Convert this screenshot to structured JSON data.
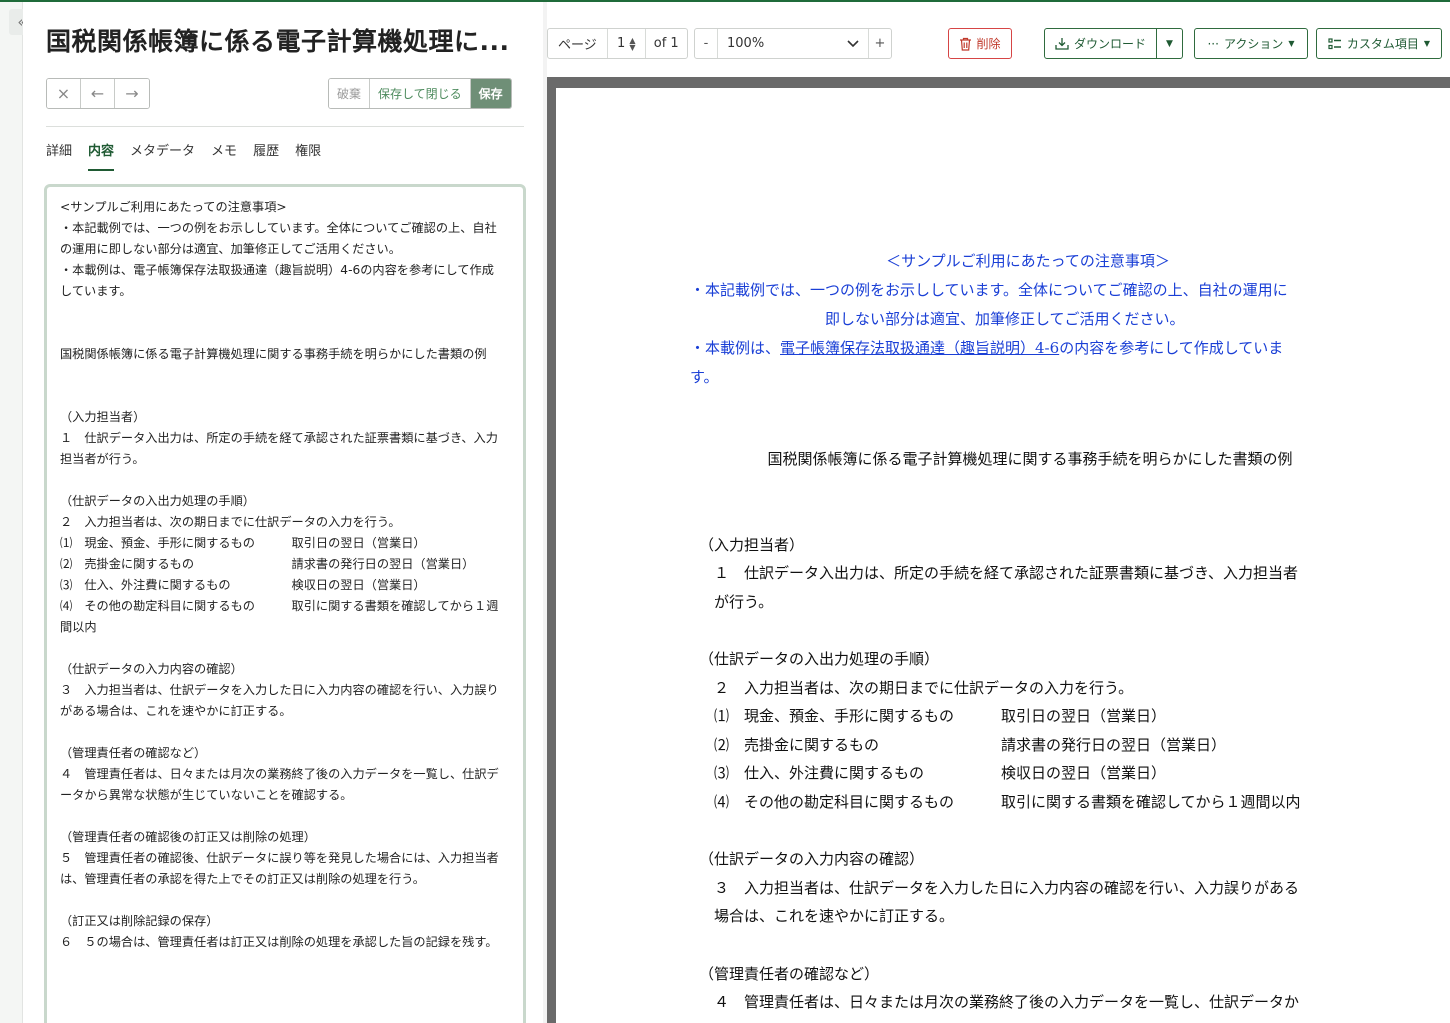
{
  "rail": {
    "collapse_icon": "«"
  },
  "document": {
    "title": "国税関係帳簿に係る電子計算機処理に..."
  },
  "nav": {
    "close": "×",
    "prev": "←",
    "next": "→"
  },
  "save": {
    "discard": "破棄",
    "save_close": "保存して閉じる",
    "save": "保存"
  },
  "tabs": [
    {
      "label": "詳細"
    },
    {
      "label": "内容",
      "active": true
    },
    {
      "label": "メタデータ"
    },
    {
      "label": "メモ"
    },
    {
      "label": "履歴"
    },
    {
      "label": "権限"
    }
  ],
  "content": {
    "text": "<サンプルご利用にあたっての注意事項>\n・本記載例では、一つの例をお示ししています。全体についてご確認の上、自社の運用に即しない部分は適宜、加筆修正してご活用ください。\n・本載例は、電子帳簿保存法取扱通達（趣旨説明）4-6の内容を参考にして作成しています。\n\n\n国税関係帳簿に係る電子計算機処理に関する事務手続を明らかにした書類の例\n\n\n（入力担当者）\n１　仕訳データ入出力は、所定の手続を経て承認された証票書類に基づき、入力担当者が行う。\n\n（仕訳データの入出力処理の手順）\n２　入力担当者は、次の期日までに仕訳データの入力を行う。\n⑴　現金、預金、手形に関するもの　　　取引日の翌日（営業日）\n⑵　売掛金に関するもの　　　　　　　　請求書の発行日の翌日（営業日）\n⑶　仕入、外注費に関するもの　　　　　検収日の翌日（営業日）\n⑷　その他の勘定科目に関するもの　　　取引に関する書類を確認してから１週間以内\n\n（仕訳データの入力内容の確認）\n３　入力担当者は、仕訳データを入力した日に入力内容の確認を行い、入力誤りがある場合は、これを速やかに訂正する。\n\n（管理責任者の確認など）\n４　管理責任者は、日々または月次の業務終了後の入力データを一覧し、仕訳データから異常な状態が生じていないことを確認する。\n\n（管理責任者の確認後の訂正又は削除の処理）\n５　管理責任者の確認後、仕訳データに誤り等を発見した場合には、入力担当者は、管理責任者の承認を得た上でその訂正又は削除の処理を行う。\n\n（訂正又は削除記録の保存）\n６　５の場合は、管理責任者は訂正又は削除の処理を承認した旨の記録を残す。"
  },
  "viewer": {
    "page_label": "ページ",
    "page_current": "1",
    "page_of": "of 1",
    "zoom_minus": "-",
    "zoom_value": "100%",
    "zoom_plus": "+",
    "delete": "削除",
    "download": "ダウンロード",
    "actions": "アクション",
    "custom": "カスタム項目"
  },
  "paper": {
    "note_title": "＜サンプルご利用にあたっての注意事項＞",
    "note1a": "・本記載例では、一つの例をお示ししています。全体についてご確認の上、自社の運用に",
    "note1b": "即しない部分は適宜、加筆修正してご活用ください。",
    "note2_prefix": "・本載例は、",
    "note2_link": "電子帳簿保存法取扱通達（趣旨説明）4-6",
    "note2_suffix": "の内容を参考にして作成していま",
    "note2_tail": "す。",
    "doc_title": "国税関係帳簿に係る電子計算機処理に関する事務手続を明らかにした書類の例",
    "s1_head": "（入力担当者）",
    "s1_a": "　１　仕訳データ入出力は、所定の手続を経て承認された証票書類に基づき、入力担当者",
    "s1_b": "　が行う。",
    "s2_head": "（仕訳データの入出力処理の手順）",
    "s2_a": "　２　入力担当者は、次の期日までに仕訳データの入力を行う。",
    "items": [
      {
        "l": "　⑴　現金、預金、手形に関するもの",
        "r": "取引日の翌日（営業日）"
      },
      {
        "l": "　⑵　売掛金に関するもの",
        "r": "請求書の発行日の翌日（営業日）"
      },
      {
        "l": "　⑶　仕入、外注費に関するもの",
        "r": "検収日の翌日（営業日）"
      },
      {
        "l": "　⑷　その他の勘定科目に関するもの",
        "r": "取引に関する書類を確認してから１週間以内"
      }
    ],
    "s3_head": "（仕訳データの入力内容の確認）",
    "s3_a": "　３　入力担当者は、仕訳データを入力した日に入力内容の確認を行い、入力誤りがある",
    "s3_b": "　場合は、これを速やかに訂正する。",
    "s4_head": "（管理責任者の確認など）",
    "s4_a": "　４　管理責任者は、日々または月次の業務終了後の入力データを一覧し、仕訳データか"
  }
}
